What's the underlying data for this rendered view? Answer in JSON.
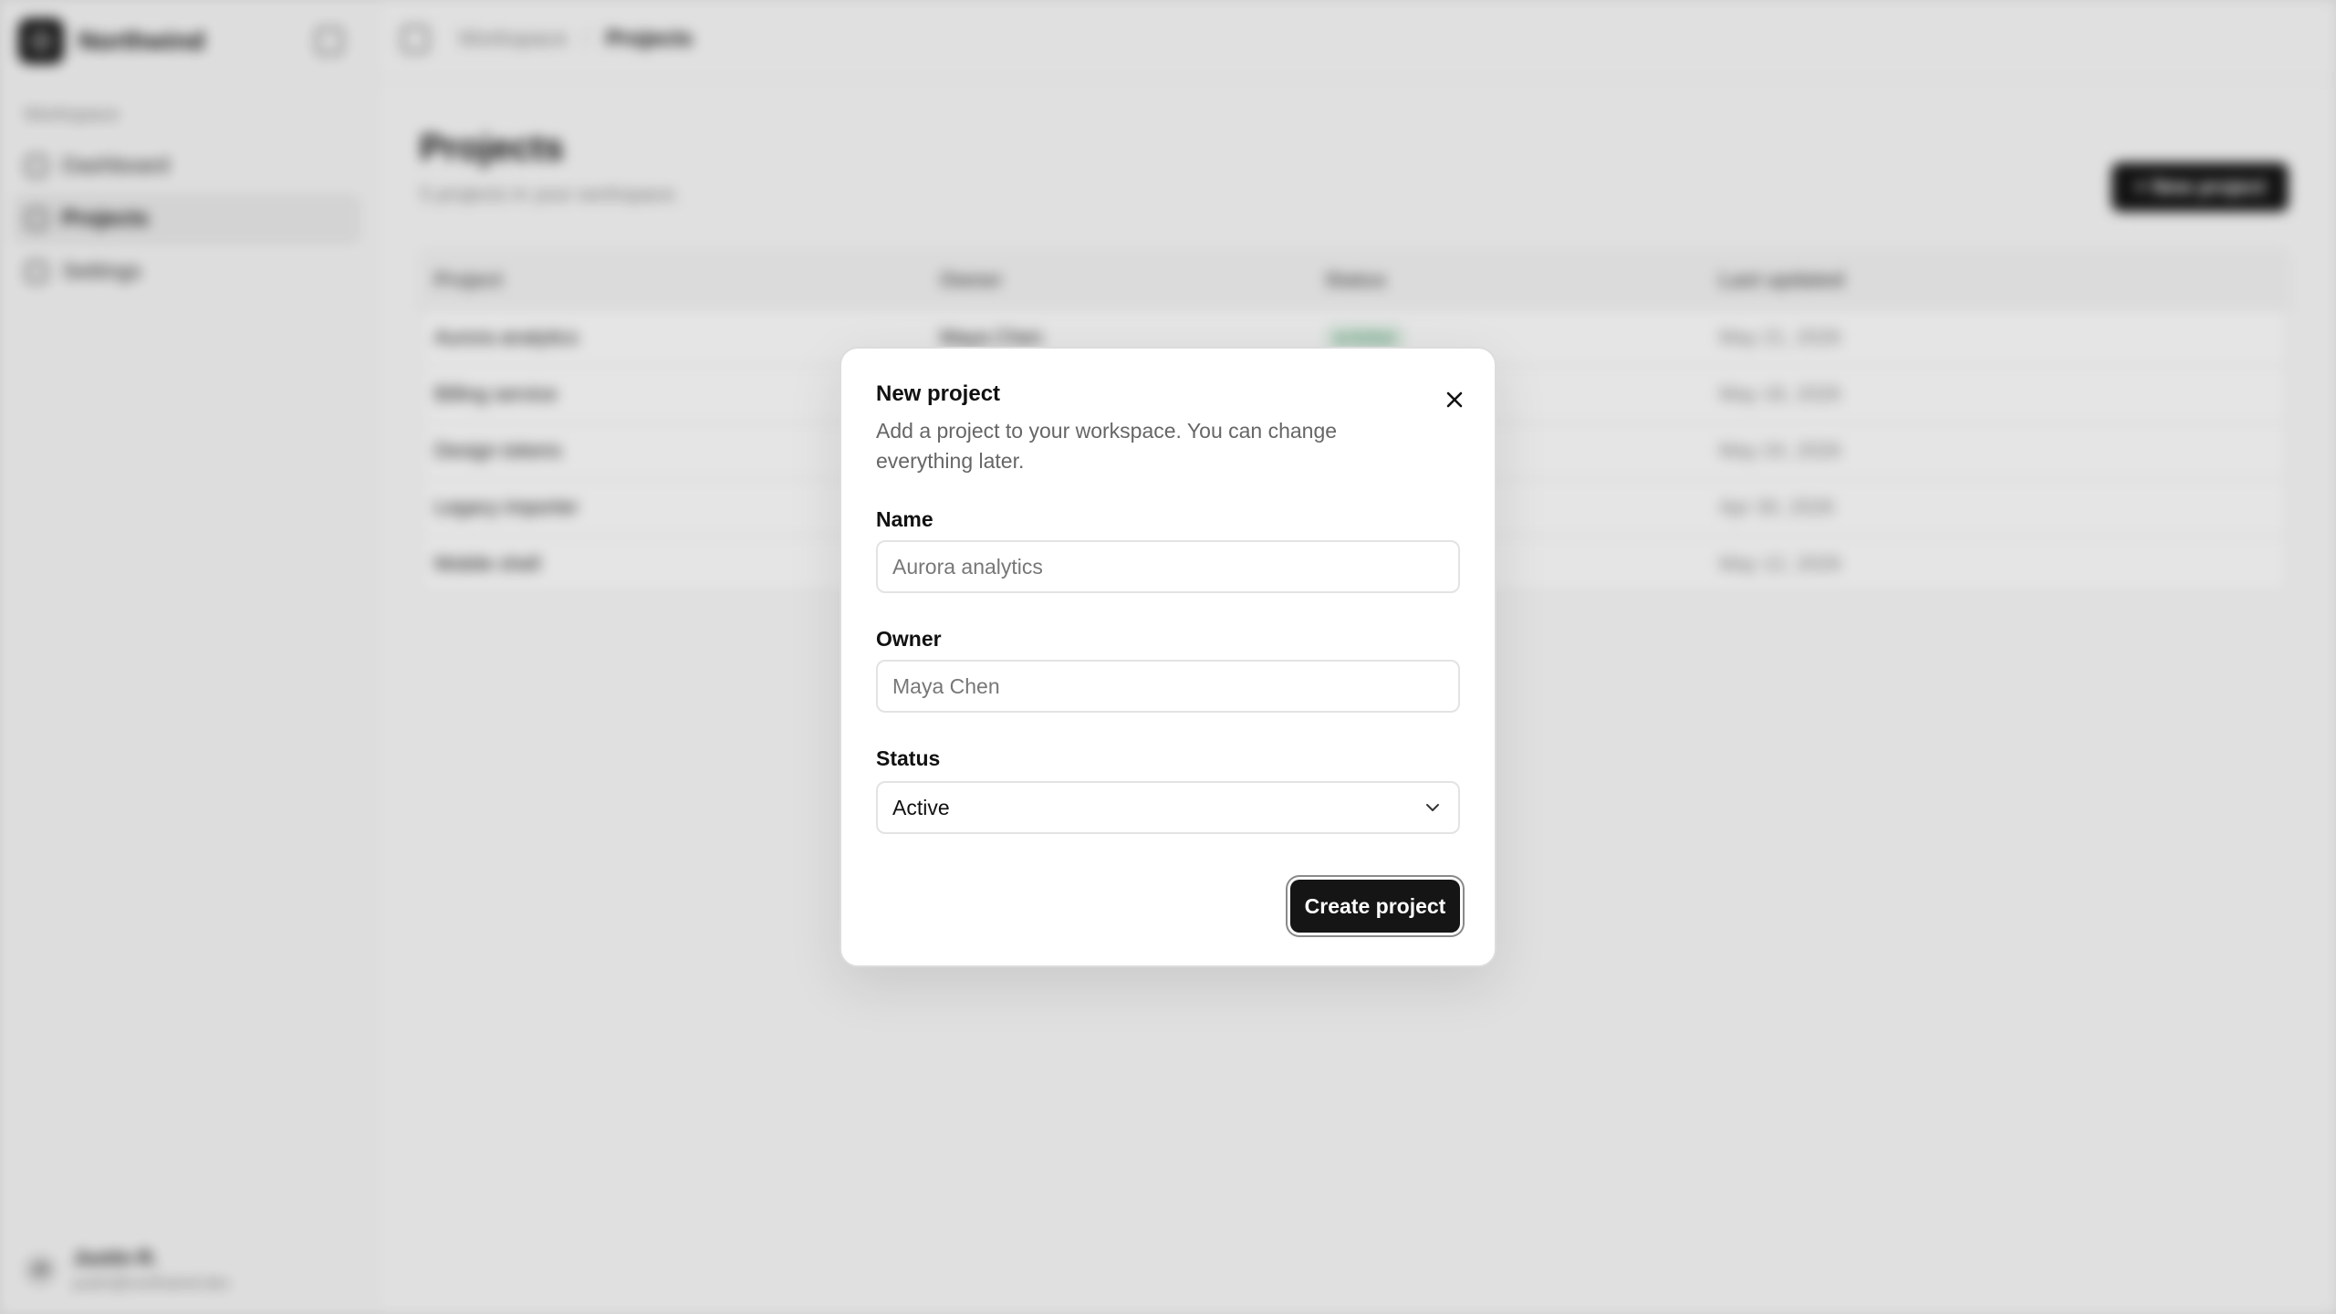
{
  "app": {
    "brand": "Northwind",
    "sidebar": {
      "group_label": "Workspace",
      "items": [
        {
          "label": "Dashboard",
          "icon": "dashboard-icon",
          "active": false
        },
        {
          "label": "Projects",
          "icon": "folder-icon",
          "active": true
        },
        {
          "label": "Settings",
          "icon": "gear-icon",
          "active": false
        }
      ],
      "user": {
        "initials": "JR",
        "name": "Justin R.",
        "email": "justin@northwind.dev"
      }
    },
    "header": {
      "breadcrumb": [
        "Workspace",
        "Projects"
      ]
    },
    "main": {
      "title": "Projects",
      "subtitle": "5 projects in your workspace.",
      "new_button_label": "+ New project",
      "table": {
        "columns": [
          "Project",
          "Owner",
          "Status",
          "Last updated"
        ],
        "rows": [
          {
            "project": "Aurora analytics",
            "owner": "Maya Chen",
            "status": "● Active",
            "updated": "May 21, 2026"
          },
          {
            "project": "Billing service",
            "owner": "",
            "status": "",
            "updated": "May 18, 2026"
          },
          {
            "project": "Design tokens",
            "owner": "",
            "status": "",
            "updated": "May 24, 2026"
          },
          {
            "project": "Legacy importer",
            "owner": "",
            "status": "",
            "updated": "Apr 30, 2026"
          },
          {
            "project": "Mobile shell",
            "owner": "",
            "status": "",
            "updated": "May 12, 2026"
          }
        ]
      }
    }
  },
  "modal": {
    "title": "New project",
    "description": "Add a project to your workspace. You can change everything later.",
    "name_label": "Name",
    "name_placeholder": "Aurora analytics",
    "owner_label": "Owner",
    "owner_placeholder": "Maya Chen",
    "status_label": "Status",
    "status_value": "Active",
    "submit_label": "Create project"
  },
  "colors": {
    "primary_button": "#151515",
    "overlay": "rgba(0,0,0,0.10)",
    "active_status": "#2e8a52"
  }
}
